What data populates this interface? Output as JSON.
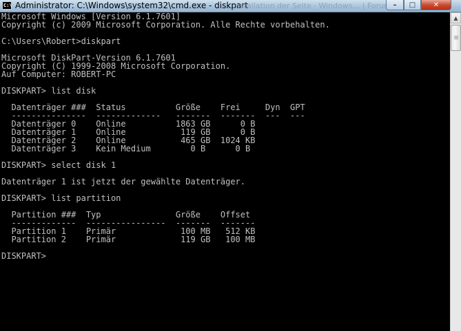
{
  "window": {
    "title": "Administrator: C:\\Windows\\system32\\cmd.exe - diskpart",
    "background_title": "…nstallation der Seite · Windows… | Forum",
    "icon_text": "C:\\",
    "buttons": {
      "minimize": "–",
      "maximize": "□",
      "close": "✕"
    }
  },
  "colors": {
    "console_bg": "#000000",
    "console_fg": "#c0c0c0"
  },
  "console": {
    "lines": [
      "Microsoft Windows [Version 6.1.7601]",
      "Copyright (c) 2009 Microsoft Corporation. Alle Rechte vorbehalten.",
      "",
      "C:\\Users\\Robert>diskpart",
      "",
      "Microsoft DiskPart-Version 6.1.7601",
      "Copyright (C) 1999-2008 Microsoft Corporation.",
      "Auf Computer: ROBERT-PC",
      "",
      "DISKPART> list disk",
      "",
      "  Datenträger ###  Status          Größe    Frei     Dyn  GPT",
      "  ---------------  -------------   -------  -------  ---  ---",
      "  Datenträger 0    Online          1863 GB      0 B",
      "  Datenträger 1    Online           119 GB      0 B",
      "  Datenträger 2    Online           465 GB  1024 KB",
      "  Datenträger 3    Kein Medium        0 B      0 B",
      "",
      "DISKPART> select disk 1",
      "",
      "Datenträger 1 ist jetzt der gewählte Datenträger.",
      "",
      "DISKPART> list partition",
      "",
      "  Partition ###  Typ               Größe    Offset",
      "  -------------  ----------------  -------  -------",
      "  Partition 1    Primär             100 MB   512 KB",
      "  Partition 2    Primär             119 GB   100 MB",
      "",
      "DISKPART> "
    ]
  },
  "scrollbar": {
    "up_arrow": "▲",
    "position_fraction": 0.0
  }
}
